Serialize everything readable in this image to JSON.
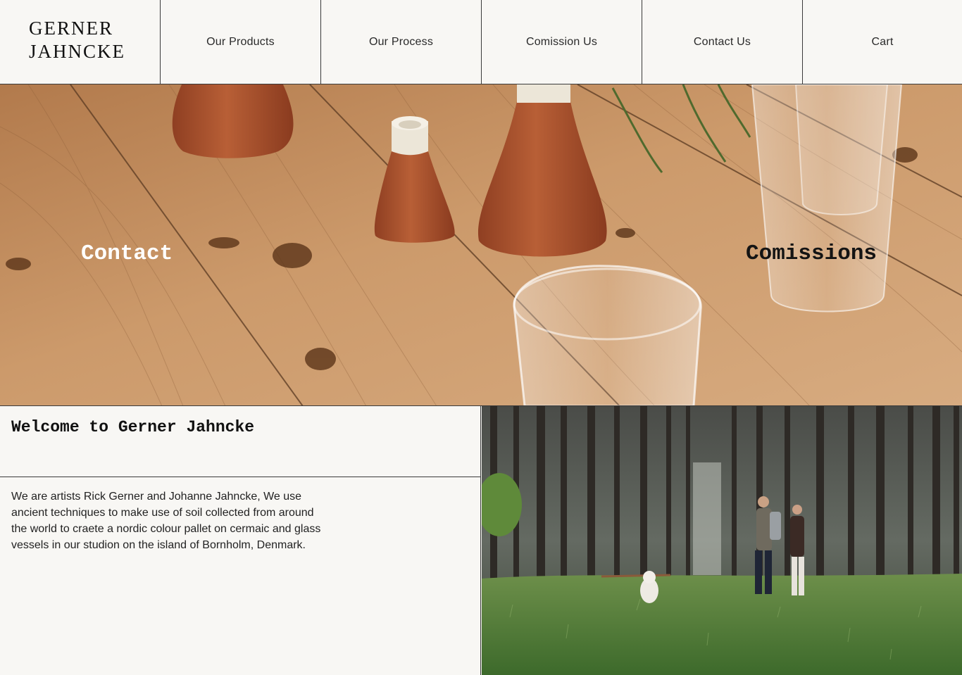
{
  "header": {
    "logo_line1": "GERNER",
    "logo_line2": "JAHNCKE",
    "nav": [
      {
        "label": "Our Products"
      },
      {
        "label": "Our Process"
      },
      {
        "label": "Comission Us"
      },
      {
        "label": "Contact Us"
      },
      {
        "label": "Cart"
      }
    ]
  },
  "hero": {
    "left_link": "Contact",
    "right_link": "Comissions"
  },
  "welcome": {
    "title": "Welcome to Gerner Jahncke",
    "body": "We are artists Rick Gerner and Johanne Jahncke, We use ancient techniques to make use of soil collected from around the world to craete a nordic colour pallet on cermaic and glass vessels in our studion on the island of Bornholm, Denmark."
  },
  "colors": {
    "background": "#f8f7f4",
    "border": "#3a3a3a",
    "wood": "#c99567",
    "terracotta": "#a9542e"
  }
}
